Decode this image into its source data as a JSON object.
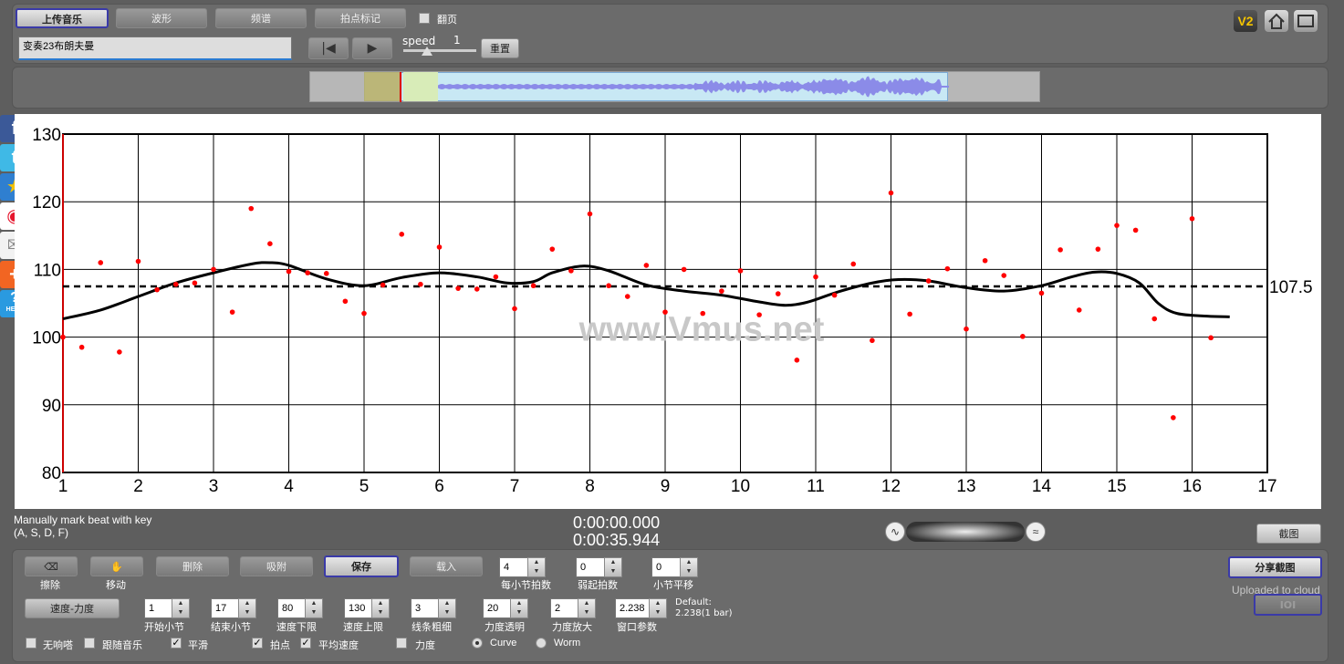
{
  "toolbar": {
    "upload_music": "上传音乐",
    "waveform": "波形",
    "spectrum": "频谱",
    "beat_mark": "拍点标记",
    "flip_page": "翻页",
    "song_title": "变奏23布朗夫曼",
    "speed_label": "speed",
    "speed_value": "1",
    "reset": "重置"
  },
  "top_right": {
    "v2_badge": "V2"
  },
  "share_icons": [
    "facebook-icon",
    "twitter-icon",
    "star-icon",
    "weibo-icon",
    "mail-icon",
    "plus-icon",
    "help-icon"
  ],
  "help_text": "HELP",
  "chart_data": {
    "type": "scatter",
    "title": "",
    "xlabel": "",
    "ylabel": "",
    "xlim": [
      1,
      17
    ],
    "ylim": [
      80,
      130
    ],
    "xticks": [
      "1",
      "2",
      "3",
      "4",
      "5",
      "6",
      "7",
      "8",
      "9",
      "10",
      "11",
      "12",
      "13",
      "14",
      "15",
      "16",
      "17"
    ],
    "yticks": [
      "80",
      "90",
      "100",
      "110",
      "120",
      "130"
    ],
    "average_value": 107.5,
    "average_label": "107.5",
    "grid": true,
    "watermark": "www.Vmus.net",
    "series": [
      {
        "type": "scatter",
        "color": "#ff0000",
        "points": [
          [
            1.0,
            100.0
          ],
          [
            1.25,
            98.5
          ],
          [
            1.5,
            111.0
          ],
          [
            1.75,
            97.8
          ],
          [
            2.0,
            111.2
          ],
          [
            2.25,
            107.0
          ],
          [
            2.5,
            107.8
          ],
          [
            2.75,
            108.0
          ],
          [
            3.0,
            110.0
          ],
          [
            3.25,
            103.7
          ],
          [
            3.5,
            119.0
          ],
          [
            3.75,
            113.8
          ],
          [
            4.0,
            109.7
          ],
          [
            4.25,
            109.5
          ],
          [
            4.5,
            109.4
          ],
          [
            4.75,
            105.3
          ],
          [
            5.0,
            103.5
          ],
          [
            5.25,
            107.7
          ],
          [
            5.5,
            115.2
          ],
          [
            5.75,
            107.8
          ],
          [
            6.0,
            113.3
          ],
          [
            6.25,
            107.2
          ],
          [
            6.5,
            107.1
          ],
          [
            6.75,
            108.9
          ],
          [
            7.0,
            104.2
          ],
          [
            7.25,
            107.6
          ],
          [
            7.5,
            113.0
          ],
          [
            7.75,
            109.8
          ],
          [
            8.0,
            118.2
          ],
          [
            8.25,
            107.6
          ],
          [
            8.5,
            106.0
          ],
          [
            8.75,
            110.6
          ],
          [
            9.0,
            103.7
          ],
          [
            9.25,
            110.0
          ],
          [
            9.5,
            103.5
          ],
          [
            9.75,
            106.8
          ],
          [
            10.0,
            109.8
          ],
          [
            10.25,
            103.3
          ],
          [
            10.5,
            106.4
          ],
          [
            10.75,
            96.6
          ],
          [
            11.0,
            108.9
          ],
          [
            11.25,
            106.2
          ],
          [
            11.5,
            110.8
          ],
          [
            11.75,
            99.5
          ],
          [
            12.0,
            121.3
          ],
          [
            12.25,
            103.4
          ],
          [
            12.5,
            108.3
          ],
          [
            12.75,
            110.1
          ],
          [
            13.0,
            101.2
          ],
          [
            13.25,
            111.3
          ],
          [
            13.5,
            109.1
          ],
          [
            13.75,
            100.1
          ],
          [
            14.0,
            106.5
          ],
          [
            14.25,
            112.9
          ],
          [
            14.5,
            104.0
          ],
          [
            14.75,
            113.0
          ],
          [
            15.0,
            116.5
          ],
          [
            15.25,
            115.8
          ],
          [
            15.5,
            102.7
          ],
          [
            15.75,
            88.1
          ],
          [
            16.0,
            117.5
          ],
          [
            16.25,
            99.9
          ]
        ]
      },
      {
        "type": "line",
        "color": "#000000",
        "points": [
          [
            1.0,
            102.7
          ],
          [
            1.5,
            104.0
          ],
          [
            2.0,
            106.0
          ],
          [
            2.5,
            108.0
          ],
          [
            3.0,
            109.5
          ],
          [
            3.5,
            110.8
          ],
          [
            3.75,
            111.0
          ],
          [
            4.0,
            110.6
          ],
          [
            4.5,
            108.6
          ],
          [
            5.0,
            107.6
          ],
          [
            5.5,
            108.8
          ],
          [
            6.0,
            109.5
          ],
          [
            6.5,
            108.9
          ],
          [
            6.9,
            108.0
          ],
          [
            7.25,
            108.2
          ],
          [
            7.5,
            109.5
          ],
          [
            7.9,
            110.5
          ],
          [
            8.25,
            109.8
          ],
          [
            8.75,
            107.7
          ],
          [
            9.25,
            106.8
          ],
          [
            9.75,
            106.2
          ],
          [
            10.25,
            105.2
          ],
          [
            10.6,
            104.7
          ],
          [
            10.9,
            105.2
          ],
          [
            11.3,
            106.7
          ],
          [
            11.75,
            108.0
          ],
          [
            12.1,
            108.5
          ],
          [
            12.5,
            108.3
          ],
          [
            13.0,
            107.3
          ],
          [
            13.5,
            106.8
          ],
          [
            14.0,
            107.6
          ],
          [
            14.4,
            108.9
          ],
          [
            14.7,
            109.6
          ],
          [
            15.0,
            109.4
          ],
          [
            15.3,
            108.0
          ],
          [
            15.55,
            105.0
          ],
          [
            15.8,
            103.5
          ],
          [
            16.2,
            103.1
          ],
          [
            16.5,
            103.0
          ]
        ]
      }
    ]
  },
  "info": {
    "hint_line1": "Manually mark beat with key",
    "hint_line2": "(A, S, D, F)",
    "time_current": "0:00:00.000",
    "time_total": "0:00:35.944",
    "screenshot": "截图"
  },
  "controls": {
    "erase": "擦除",
    "move": "移动",
    "delete": "删除",
    "snap": "吸附",
    "save": "保存",
    "load": "载入",
    "beats_per_bar": {
      "label": "每小节拍数",
      "value": "4"
    },
    "pickup_beats": {
      "label": "弱起拍数",
      "value": "0"
    },
    "bar_offset": {
      "label": "小节平移",
      "value": "0"
    },
    "share_screenshot": "分享截图",
    "uploaded": "Uploaded to cloud",
    "ioi": "IOI",
    "tempo_dynamics": "速度-力度",
    "start_bar": {
      "label": "开始小节",
      "value": "1"
    },
    "end_bar": {
      "label": "结束小节",
      "value": "17"
    },
    "tempo_min": {
      "label": "速度下限",
      "value": "80"
    },
    "tempo_max": {
      "label": "速度上限",
      "value": "130"
    },
    "line_width": {
      "label": "线条粗细",
      "value": "3"
    },
    "dyn_transparency": {
      "label": "力度透明",
      "value": "20"
    },
    "dyn_scale": {
      "label": "力度放大",
      "value": "2"
    },
    "window_param": {
      "label": "窗口参数",
      "value": "2.238"
    },
    "default_line1": "Default:",
    "default_line2": "2.238(1 bar)",
    "check_mute": "无响嗒",
    "check_follow": "跟随音乐",
    "check_smooth": "平滑",
    "check_beats": "拍点",
    "check_avg": "平均速度",
    "check_dynamics": "力度",
    "radio_curve": "Curve",
    "radio_worm": "Worm"
  }
}
